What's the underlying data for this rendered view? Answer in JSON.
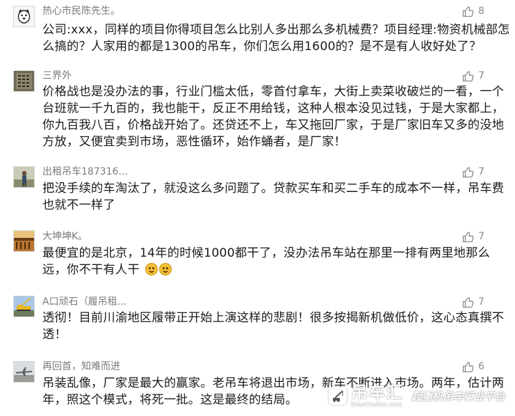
{
  "comments": [
    {
      "username": "热心市民陈先生。",
      "likes": "8",
      "lines": [
        "公司:xxx，同样的项目你得项目怎么比别人多出那么多机械费？项目经理:物资机械部怎",
        "么搞的？人家用的都是1300的吊车，你们怎么用1600的？是不是有人收好处了？"
      ]
    },
    {
      "username": "三界外",
      "likes": "7",
      "lines": [
        "价格战也是没办法的事，行业门槛太低，零首付拿车，大街上卖菜收破烂的一看，一个",
        "台班就一千九百的，我也能干，反正不用给钱，这种人根本没见过钱，于是大家都上，",
        "你九百我八百，价格战开始了。还贷还不上，车又拖回厂家，于是厂家旧车又多的没地",
        "方放，又便宜卖到市场，恶性循环，始作蛹者，是厂家！"
      ]
    },
    {
      "username": "出租吊车187316...",
      "likes": "7",
      "lines": [
        "把没手续的车淘汰了，就没这么多问题了。贷款买车和买二手车的成本不一样，吊车费",
        "也就不一样了"
      ]
    },
    {
      "username": "大坤坤K。",
      "likes": "7",
      "lines": [
        "最便宜的是北京，14年的时候1000都干了，没办法吊车站在那里一排有两里地那么",
        "远，你不干有人干"
      ],
      "emoji_count": 2
    },
    {
      "username": "A口顽石（履吊租...",
      "likes": "7",
      "lines": [
        "透彻！目前川渝地区履带正开始上演这样的悲剧！很多按揭新机做低价，这心态真撰不",
        "透！"
      ]
    },
    {
      "username": "再回首，知难而进",
      "likes": "6",
      "lines": [
        "吊装乱像，厂家是最大的赢家。老吊车将退出市场，新车不断进入市场。两年，估计两",
        "年，照这个模式，将死一批。这是最终的结局。"
      ]
    }
  ],
  "watermark": {
    "brand": "吊车汇",
    "domain": "DiaoCheHui.com",
    "slogan": "起重机吊车行业平台"
  },
  "colors": {
    "username": "#7a7a7a",
    "text": "#1b1b1b",
    "like_icon": "#8a8a8a",
    "emoji": "#f5c036"
  },
  "icons": {
    "like": "thumbs-up-icon",
    "emoji": "grin-emoji-icon",
    "logo": "crane-logo-icon"
  }
}
